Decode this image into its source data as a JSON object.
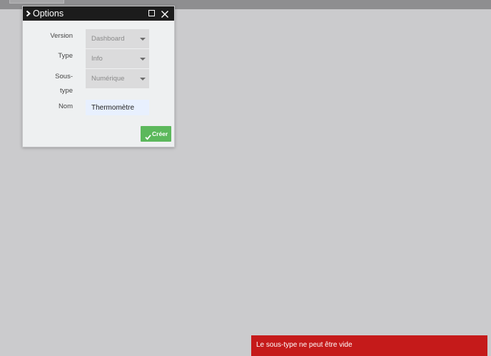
{
  "dialog": {
    "title": "Options",
    "icons": {
      "collapse": "chevron-right-icon",
      "maximize": "maximize-icon",
      "close": "close-icon"
    },
    "fields": {
      "version": {
        "label": "Version",
        "value": "Dashboard"
      },
      "type": {
        "label": "Type",
        "value": "Info"
      },
      "subtype": {
        "label_line1": "Sous-",
        "label_line2": "type",
        "value": "Numérique"
      },
      "name": {
        "label": "Nom",
        "value": "Thermomètre"
      }
    },
    "create_button": {
      "label": "Créer",
      "icon": "check-icon"
    }
  },
  "toast": {
    "message": "Le sous-type ne peut être vide"
  },
  "colors": {
    "background": "#cbcbcd",
    "titlebar": "#1c1c1c",
    "create_button": "#5cb85c",
    "toast": "#c51a1a"
  }
}
